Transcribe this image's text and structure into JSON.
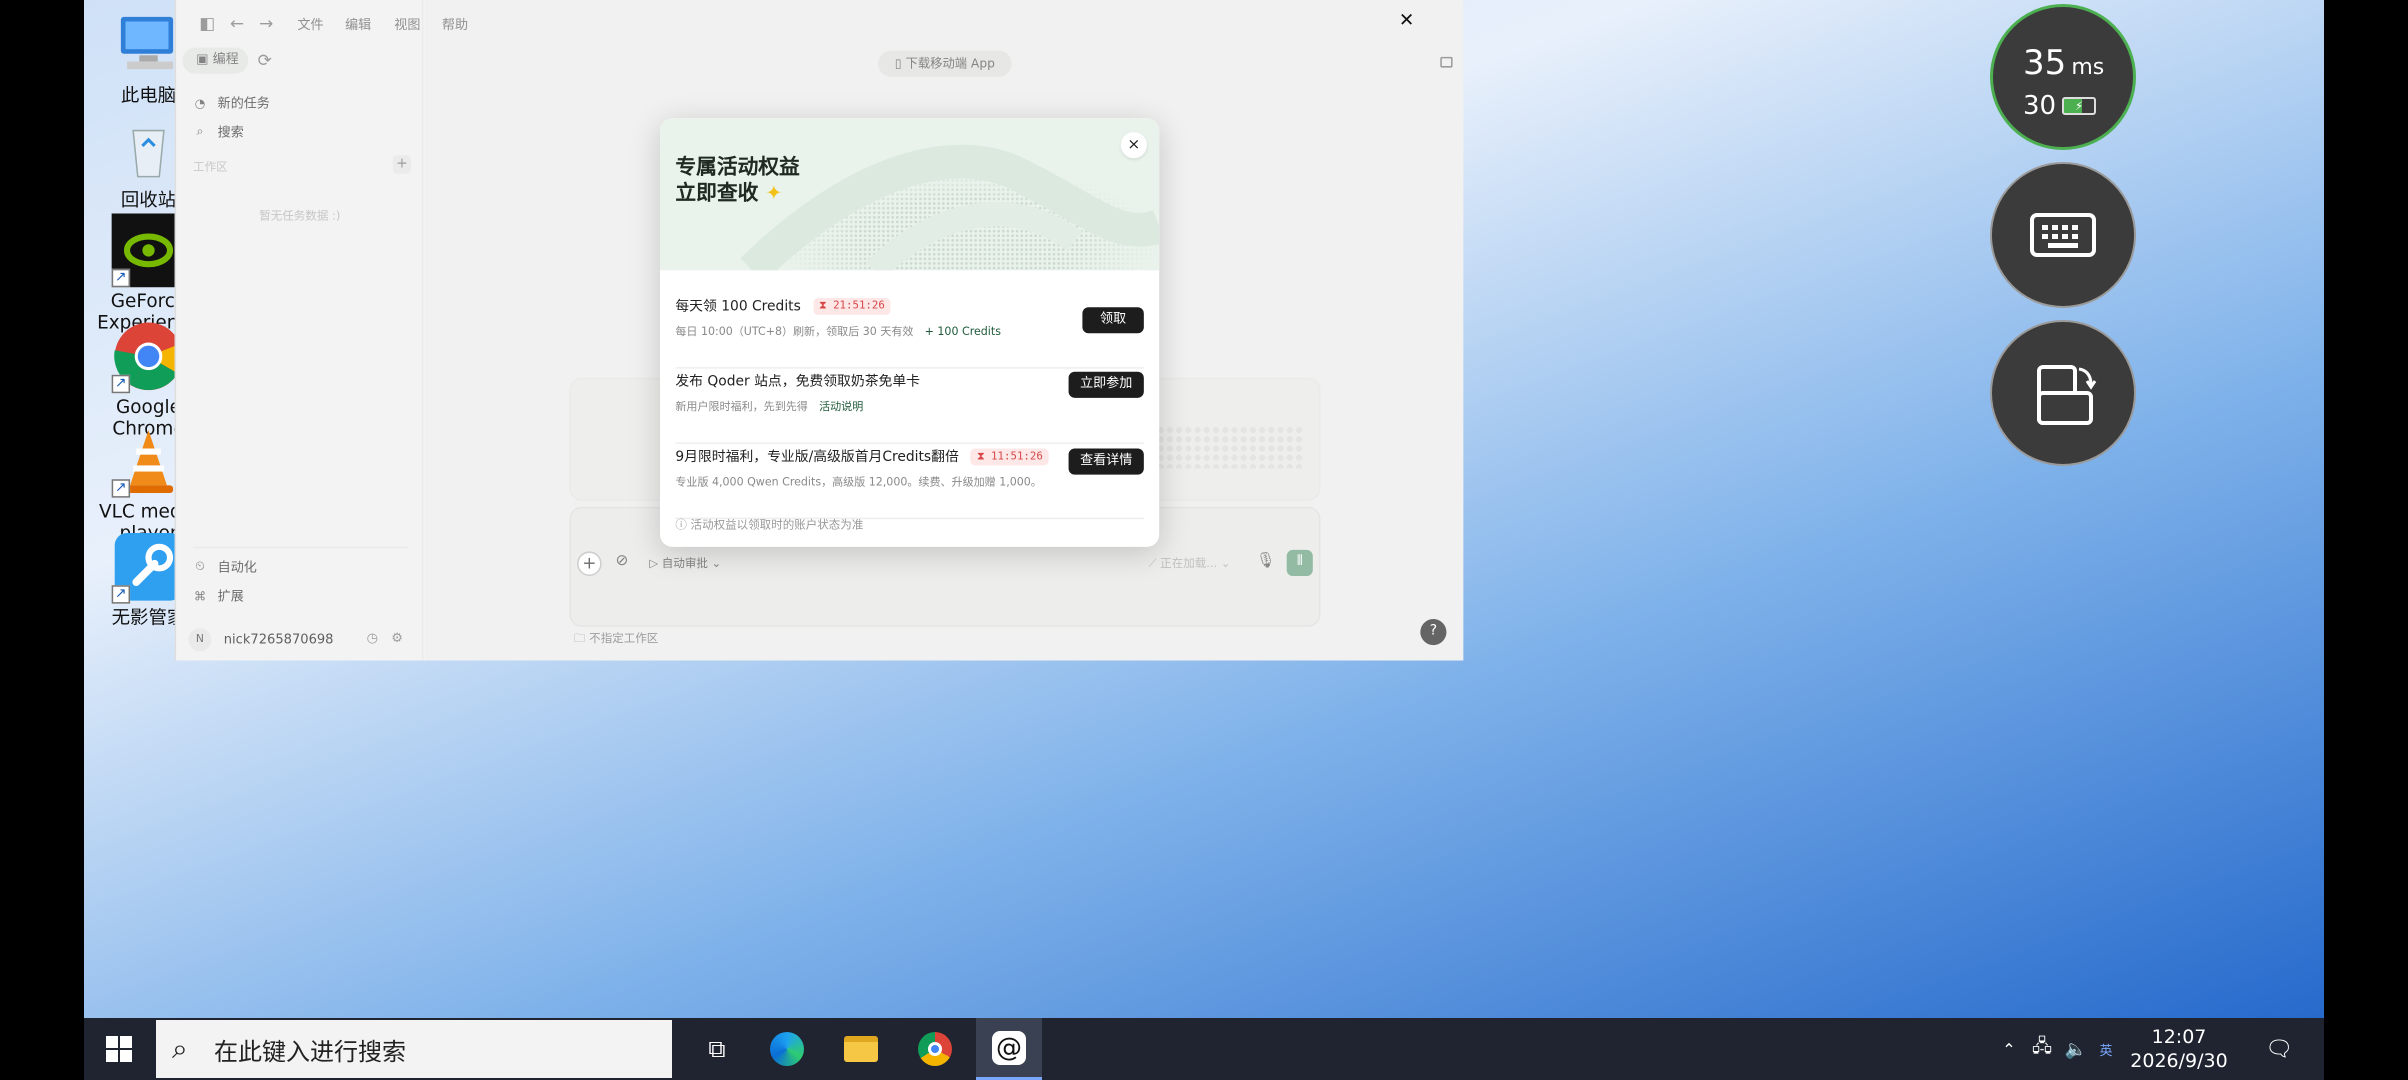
{
  "desktop": {
    "icons": [
      {
        "label": "此电脑"
      },
      {
        "label": "回收站"
      },
      {
        "label": "GeForce Experience"
      },
      {
        "label": "Google Chrome"
      },
      {
        "label": "VLC media player"
      },
      {
        "label": "无影管家"
      }
    ]
  },
  "app": {
    "menu": [
      "文件",
      "编辑",
      "视图",
      "帮助"
    ],
    "mode_label": "编程",
    "sidebar": {
      "new_task": "新的任务",
      "search": "搜索",
      "workspace_label": "工作区",
      "empty_text": "暂无任务数据 :)",
      "automation": "自动化",
      "extensions": "扩展",
      "avatar_initial": "N",
      "username": "nick7265870698"
    },
    "download_btn": "下载移动端 App",
    "composer": {
      "auto_review": "自动审批",
      "loading": "正在加载...",
      "no_workspace": "不指定工作区"
    }
  },
  "modal": {
    "title_line1": "专属活动权益",
    "title_line2": "立即查收",
    "close": "×",
    "offers": [
      {
        "title": "每天领 100 Credits",
        "timer": "21:51:26",
        "sub": "每日 10:00（UTC+8）刷新，领取后 30 天有效",
        "extra": "+ 100 Credits",
        "button": "领取"
      },
      {
        "title": "发布 Qoder 站点，免费领取奶茶免单卡",
        "sub": "新用户限时福利，先到先得",
        "extra": "活动说明",
        "button": "立即参加"
      },
      {
        "title": "9月限时福利，专业版/高级版首月Credits翻倍",
        "timer": "11:51:26",
        "sub": "专业版 4,000 Qwen Credits，高级版 12,000。续费、升级加赠 1,000。",
        "button": "查看详情"
      }
    ],
    "footnote": "活动权益以领取时的账户状态为准"
  },
  "overlay": {
    "latency_value": "35",
    "latency_unit": "ms",
    "fps": "30"
  },
  "taskbar": {
    "search_placeholder": "在此键入进行搜索",
    "time": "12:07",
    "date": "2026/9/30",
    "ime": "英"
  }
}
